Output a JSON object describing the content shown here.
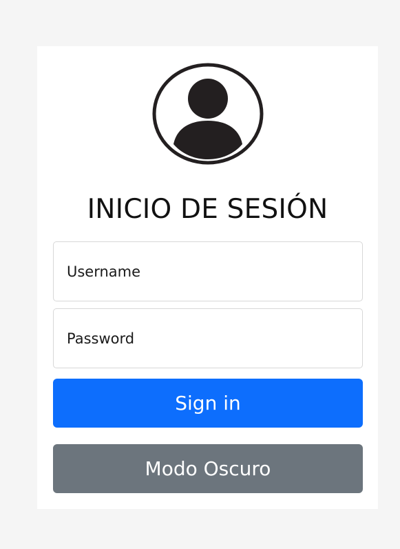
{
  "login": {
    "title": "INICIO DE SESIÓN",
    "username_placeholder": "Username",
    "password_placeholder": "Password",
    "signin_label": "Sign in",
    "dark_mode_label": "Modo Oscuro"
  },
  "icons": {
    "avatar": "user-circle-icon"
  },
  "colors": {
    "page_background": "#f5f5f5",
    "card_background": "#ffffff",
    "primary_button": "#0d6efd",
    "secondary_button": "#6c757d",
    "icon": "#231f20"
  }
}
